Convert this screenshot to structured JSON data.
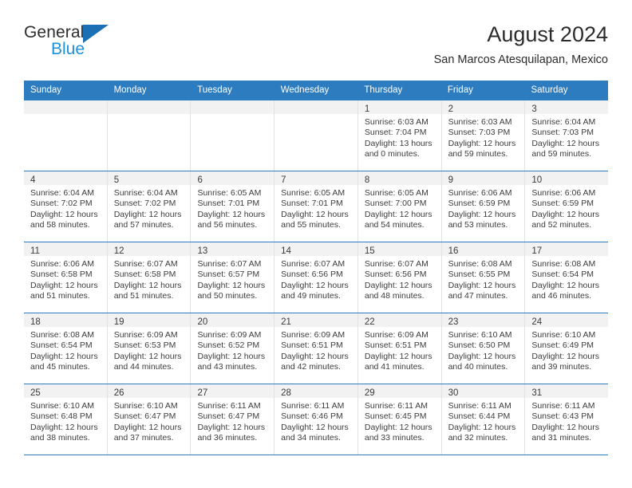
{
  "brand": {
    "name_top": "General",
    "name_bottom": "Blue",
    "triangle_color": "#1a6fb5",
    "blue_color": "#1d8fdb"
  },
  "header": {
    "month_title": "August 2024",
    "location": "San Marcos Atesquilapan, Mexico"
  },
  "theme": {
    "header_blue": "#2e7cc0",
    "date_strip": "#f2f2f2",
    "text": "#3c3c3c"
  },
  "calendar": {
    "weekdays": [
      "Sunday",
      "Monday",
      "Tuesday",
      "Wednesday",
      "Thursday",
      "Friday",
      "Saturday"
    ],
    "weeks": [
      [
        {
          "day": "",
          "sunrise": "",
          "sunset": "",
          "daylight1": "",
          "daylight2": "",
          "empty": true
        },
        {
          "day": "",
          "sunrise": "",
          "sunset": "",
          "daylight1": "",
          "daylight2": "",
          "empty": true
        },
        {
          "day": "",
          "sunrise": "",
          "sunset": "",
          "daylight1": "",
          "daylight2": "",
          "empty": true
        },
        {
          "day": "",
          "sunrise": "",
          "sunset": "",
          "daylight1": "",
          "daylight2": "",
          "empty": true
        },
        {
          "day": "1",
          "sunrise": "Sunrise: 6:03 AM",
          "sunset": "Sunset: 7:04 PM",
          "daylight1": "Daylight: 13 hours",
          "daylight2": "and 0 minutes."
        },
        {
          "day": "2",
          "sunrise": "Sunrise: 6:03 AM",
          "sunset": "Sunset: 7:03 PM",
          "daylight1": "Daylight: 12 hours",
          "daylight2": "and 59 minutes."
        },
        {
          "day": "3",
          "sunrise": "Sunrise: 6:04 AM",
          "sunset": "Sunset: 7:03 PM",
          "daylight1": "Daylight: 12 hours",
          "daylight2": "and 59 minutes."
        }
      ],
      [
        {
          "day": "4",
          "sunrise": "Sunrise: 6:04 AM",
          "sunset": "Sunset: 7:02 PM",
          "daylight1": "Daylight: 12 hours",
          "daylight2": "and 58 minutes."
        },
        {
          "day": "5",
          "sunrise": "Sunrise: 6:04 AM",
          "sunset": "Sunset: 7:02 PM",
          "daylight1": "Daylight: 12 hours",
          "daylight2": "and 57 minutes."
        },
        {
          "day": "6",
          "sunrise": "Sunrise: 6:05 AM",
          "sunset": "Sunset: 7:01 PM",
          "daylight1": "Daylight: 12 hours",
          "daylight2": "and 56 minutes."
        },
        {
          "day": "7",
          "sunrise": "Sunrise: 6:05 AM",
          "sunset": "Sunset: 7:01 PM",
          "daylight1": "Daylight: 12 hours",
          "daylight2": "and 55 minutes."
        },
        {
          "day": "8",
          "sunrise": "Sunrise: 6:05 AM",
          "sunset": "Sunset: 7:00 PM",
          "daylight1": "Daylight: 12 hours",
          "daylight2": "and 54 minutes."
        },
        {
          "day": "9",
          "sunrise": "Sunrise: 6:06 AM",
          "sunset": "Sunset: 6:59 PM",
          "daylight1": "Daylight: 12 hours",
          "daylight2": "and 53 minutes."
        },
        {
          "day": "10",
          "sunrise": "Sunrise: 6:06 AM",
          "sunset": "Sunset: 6:59 PM",
          "daylight1": "Daylight: 12 hours",
          "daylight2": "and 52 minutes."
        }
      ],
      [
        {
          "day": "11",
          "sunrise": "Sunrise: 6:06 AM",
          "sunset": "Sunset: 6:58 PM",
          "daylight1": "Daylight: 12 hours",
          "daylight2": "and 51 minutes."
        },
        {
          "day": "12",
          "sunrise": "Sunrise: 6:07 AM",
          "sunset": "Sunset: 6:58 PM",
          "daylight1": "Daylight: 12 hours",
          "daylight2": "and 51 minutes."
        },
        {
          "day": "13",
          "sunrise": "Sunrise: 6:07 AM",
          "sunset": "Sunset: 6:57 PM",
          "daylight1": "Daylight: 12 hours",
          "daylight2": "and 50 minutes."
        },
        {
          "day": "14",
          "sunrise": "Sunrise: 6:07 AM",
          "sunset": "Sunset: 6:56 PM",
          "daylight1": "Daylight: 12 hours",
          "daylight2": "and 49 minutes."
        },
        {
          "day": "15",
          "sunrise": "Sunrise: 6:07 AM",
          "sunset": "Sunset: 6:56 PM",
          "daylight1": "Daylight: 12 hours",
          "daylight2": "and 48 minutes."
        },
        {
          "day": "16",
          "sunrise": "Sunrise: 6:08 AM",
          "sunset": "Sunset: 6:55 PM",
          "daylight1": "Daylight: 12 hours",
          "daylight2": "and 47 minutes."
        },
        {
          "day": "17",
          "sunrise": "Sunrise: 6:08 AM",
          "sunset": "Sunset: 6:54 PM",
          "daylight1": "Daylight: 12 hours",
          "daylight2": "and 46 minutes."
        }
      ],
      [
        {
          "day": "18",
          "sunrise": "Sunrise: 6:08 AM",
          "sunset": "Sunset: 6:54 PM",
          "daylight1": "Daylight: 12 hours",
          "daylight2": "and 45 minutes."
        },
        {
          "day": "19",
          "sunrise": "Sunrise: 6:09 AM",
          "sunset": "Sunset: 6:53 PM",
          "daylight1": "Daylight: 12 hours",
          "daylight2": "and 44 minutes."
        },
        {
          "day": "20",
          "sunrise": "Sunrise: 6:09 AM",
          "sunset": "Sunset: 6:52 PM",
          "daylight1": "Daylight: 12 hours",
          "daylight2": "and 43 minutes."
        },
        {
          "day": "21",
          "sunrise": "Sunrise: 6:09 AM",
          "sunset": "Sunset: 6:51 PM",
          "daylight1": "Daylight: 12 hours",
          "daylight2": "and 42 minutes."
        },
        {
          "day": "22",
          "sunrise": "Sunrise: 6:09 AM",
          "sunset": "Sunset: 6:51 PM",
          "daylight1": "Daylight: 12 hours",
          "daylight2": "and 41 minutes."
        },
        {
          "day": "23",
          "sunrise": "Sunrise: 6:10 AM",
          "sunset": "Sunset: 6:50 PM",
          "daylight1": "Daylight: 12 hours",
          "daylight2": "and 40 minutes."
        },
        {
          "day": "24",
          "sunrise": "Sunrise: 6:10 AM",
          "sunset": "Sunset: 6:49 PM",
          "daylight1": "Daylight: 12 hours",
          "daylight2": "and 39 minutes."
        }
      ],
      [
        {
          "day": "25",
          "sunrise": "Sunrise: 6:10 AM",
          "sunset": "Sunset: 6:48 PM",
          "daylight1": "Daylight: 12 hours",
          "daylight2": "and 38 minutes."
        },
        {
          "day": "26",
          "sunrise": "Sunrise: 6:10 AM",
          "sunset": "Sunset: 6:47 PM",
          "daylight1": "Daylight: 12 hours",
          "daylight2": "and 37 minutes."
        },
        {
          "day": "27",
          "sunrise": "Sunrise: 6:11 AM",
          "sunset": "Sunset: 6:47 PM",
          "daylight1": "Daylight: 12 hours",
          "daylight2": "and 36 minutes."
        },
        {
          "day": "28",
          "sunrise": "Sunrise: 6:11 AM",
          "sunset": "Sunset: 6:46 PM",
          "daylight1": "Daylight: 12 hours",
          "daylight2": "and 34 minutes."
        },
        {
          "day": "29",
          "sunrise": "Sunrise: 6:11 AM",
          "sunset": "Sunset: 6:45 PM",
          "daylight1": "Daylight: 12 hours",
          "daylight2": "and 33 minutes."
        },
        {
          "day": "30",
          "sunrise": "Sunrise: 6:11 AM",
          "sunset": "Sunset: 6:44 PM",
          "daylight1": "Daylight: 12 hours",
          "daylight2": "and 32 minutes."
        },
        {
          "day": "31",
          "sunrise": "Sunrise: 6:11 AM",
          "sunset": "Sunset: 6:43 PM",
          "daylight1": "Daylight: 12 hours",
          "daylight2": "and 31 minutes."
        }
      ]
    ]
  }
}
